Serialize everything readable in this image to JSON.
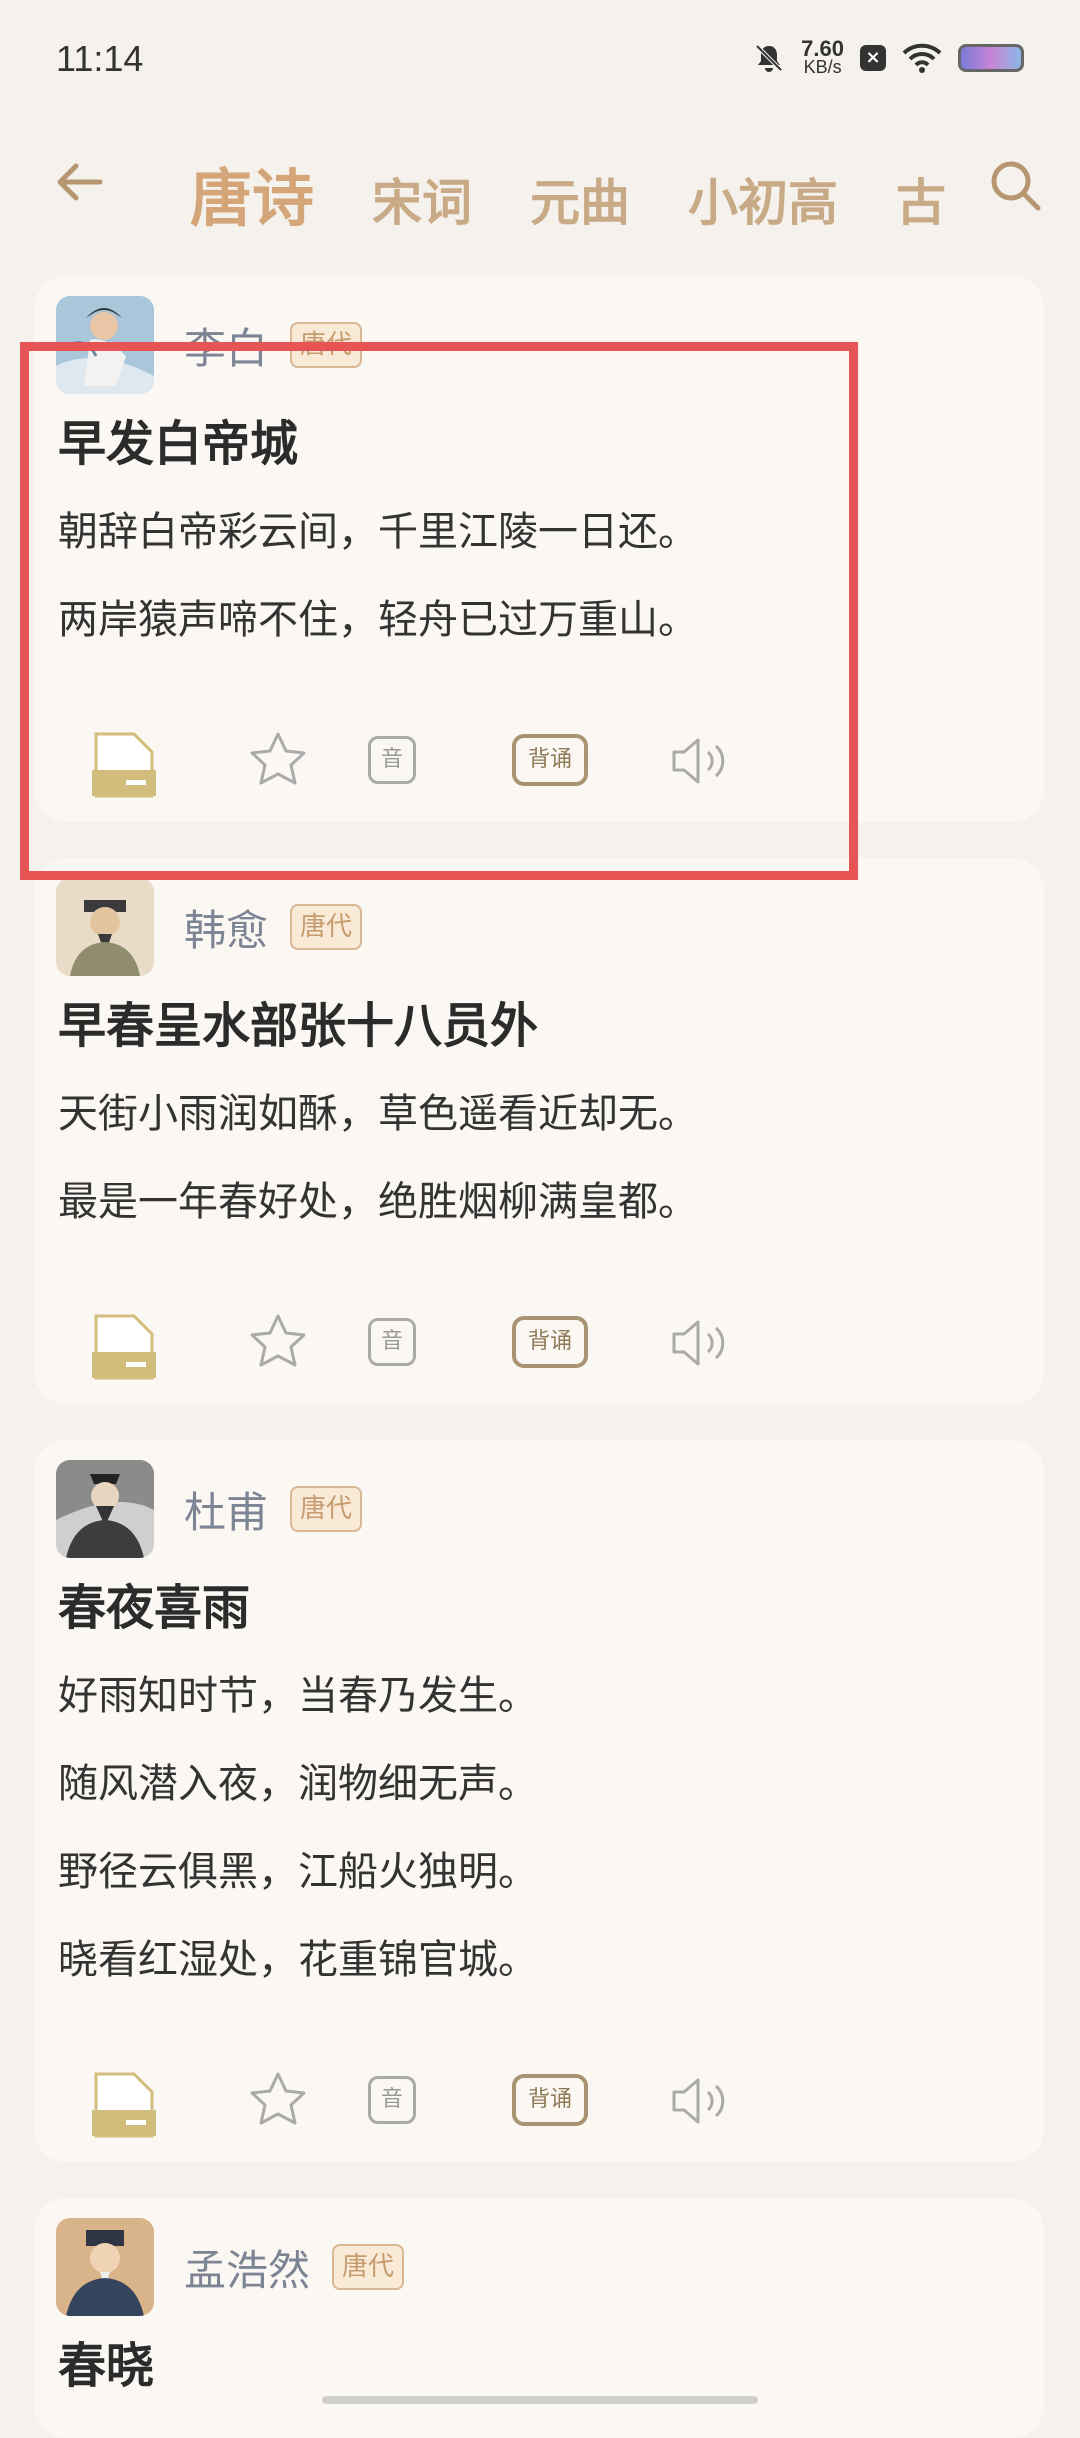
{
  "status": {
    "time": "11:14",
    "speed_value": "7.60",
    "speed_unit": "KB/s"
  },
  "nav": {
    "tabs": [
      "唐诗",
      "宋词",
      "元曲",
      "小初高",
      "古"
    ],
    "active_tab": "唐诗"
  },
  "cards": [
    {
      "author": "李白",
      "dynasty": "唐代",
      "title": "早发白帝城",
      "lines": [
        "朝辞白帝彩云间，千里江陵一日还。",
        "两岸猿声啼不住，轻舟已过万重山。"
      ],
      "recite_label": "背诵",
      "sound_label": "音"
    },
    {
      "author": "韩愈",
      "dynasty": "唐代",
      "title": "早春呈水部张十八员外",
      "lines": [
        "天街小雨润如酥，草色遥看近却无。",
        "最是一年春好处，绝胜烟柳满皇都。"
      ],
      "recite_label": "背诵",
      "sound_label": "音"
    },
    {
      "author": "杜甫",
      "dynasty": "唐代",
      "title": "春夜喜雨",
      "lines": [
        "好雨知时节，当春乃发生。",
        "随风潜入夜，润物细无声。",
        "野径云俱黑，江船火独明。",
        "晓看红湿处，花重锦官城。"
      ],
      "recite_label": "背诵",
      "sound_label": "音"
    },
    {
      "author": "孟浩然",
      "dynasty": "唐代",
      "title": "春晓"
    }
  ],
  "colors": {
    "accent": "#d3a579",
    "highlight": "#e75454",
    "card": "#fbf8f3",
    "background": "#f5f1ec"
  }
}
